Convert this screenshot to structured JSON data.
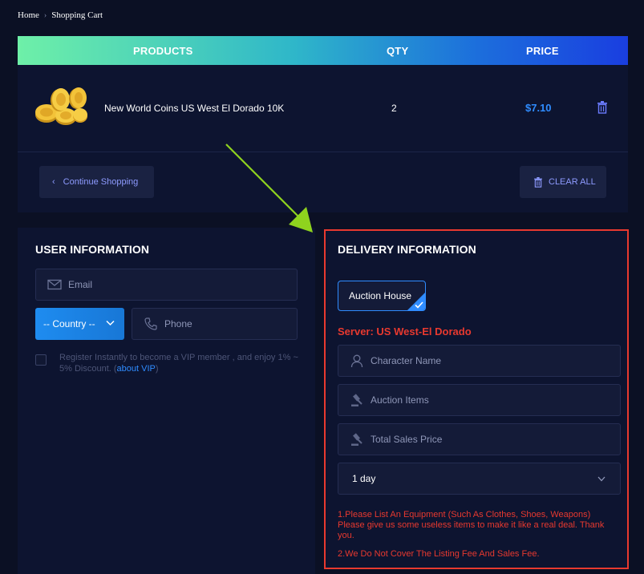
{
  "breadcrumb": {
    "home": "Home",
    "current": "Shopping Cart"
  },
  "cart": {
    "headers": {
      "products": "PRODUCTS",
      "qty": "QTY",
      "price": "PRICE"
    },
    "item": {
      "name": "New World Coins US West El Dorado 10K",
      "qty": "2",
      "price": "$7.10"
    },
    "continue_label": "Continue Shopping",
    "clear_label": "CLEAR ALL"
  },
  "user": {
    "title": "USER INFORMATION",
    "email_placeholder": "Email",
    "country_label": "-- Country --",
    "phone_placeholder": "Phone",
    "vip_text": "Register Instantly to become a VIP member , and enjoy 1% ~ 5% Discount. (",
    "vip_link": "about VIP",
    "vip_close": ")"
  },
  "delivery": {
    "title": "DELIVERY INFORMATION",
    "method_label": "Auction House",
    "server_label": "Server: US West-El Dorado",
    "character_placeholder": "Character Name",
    "items_placeholder": "Auction Items",
    "price_placeholder": "Total Sales Price",
    "duration_value": "1 day",
    "note1": "1.Please List An Equipment (Such As Clothes, Shoes, Weapons) Please give us some useless items to make it like a real deal. Thank you.",
    "note2": "2.We Do Not Cover The Listing Fee And Sales Fee."
  },
  "colors": {
    "accent": "#2f8cff",
    "warning": "#e8392f",
    "arrow": "#8fd31e"
  }
}
